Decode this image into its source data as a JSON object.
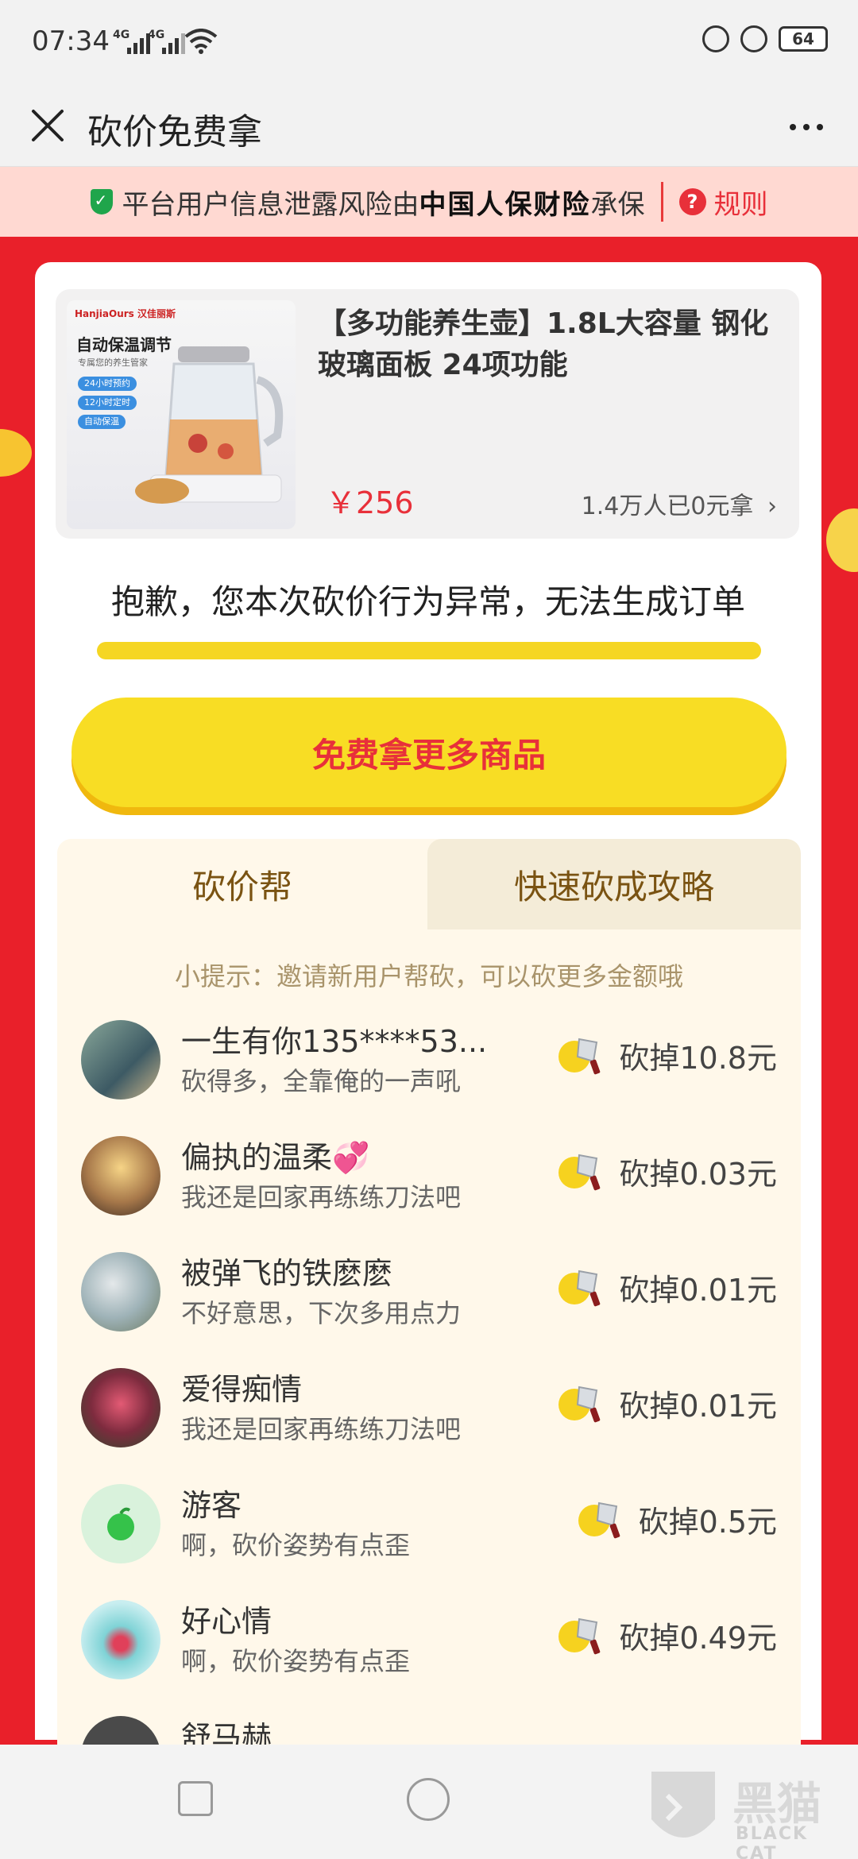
{
  "status_bar": {
    "time": "07:34",
    "network_1": "4G",
    "network_2": "4G",
    "battery": "64"
  },
  "titlebar": {
    "title": "砍价免费拿"
  },
  "insurance": {
    "text_prefix": "平台用户信息泄露风险由",
    "brand": "中国人保财险",
    "text_suffix": "承保",
    "rule": "规则",
    "rule_icon_glyph": "?"
  },
  "product": {
    "name": "【多功能养生壶】1.8L大容量 钢化玻璃面板 24项功能",
    "price": "￥256",
    "count": "1.4万人已0元拿",
    "image": {
      "brand": "HanjiaOurs 汉佳丽斯",
      "headline": "自动保温调节",
      "sub": "专属您的养生管家",
      "tags": [
        "24小时预约",
        "12小时定时",
        "自动保温"
      ]
    }
  },
  "message": "抱歉，您本次砍价行为异常，无法生成订单",
  "cta_label": "免费拿更多商品",
  "tabs": [
    {
      "label": "砍价帮",
      "active": true
    },
    {
      "label": "快速砍成攻略",
      "active": false
    }
  ],
  "tip": "小提示：邀请新用户帮砍，可以砍更多金额哦",
  "helpers": [
    {
      "name": "一生有你135****53...",
      "message": "砍得多，全靠俺的一声吼",
      "amount": "砍掉10.8元"
    },
    {
      "name": "偏执的温柔💞",
      "message": "我还是回家再练练刀法吧",
      "amount": "砍掉0.03元"
    },
    {
      "name": "被弹飞的铁麽麽",
      "message": "不好意思，下次多用点力",
      "amount": "砍掉0.01元"
    },
    {
      "name": "爱得痴情",
      "message": "我还是回家再练练刀法吧",
      "amount": "砍掉0.01元"
    },
    {
      "name": "游客",
      "message": "啊，砍价姿势有点歪",
      "amount": "砍掉0.5元"
    },
    {
      "name": "好心情",
      "message": "啊，砍价姿势有点歪",
      "amount": "砍掉0.49元"
    },
    {
      "name": "舒马赫",
      "message": "",
      "amount": ""
    }
  ],
  "watermark": {
    "text": "黑猫",
    "sub": "BLACK CAT"
  },
  "colors": {
    "accent_red": "#e8303a",
    "cta_yellow": "#f8dd24",
    "helper_bg": "#fff8ea"
  }
}
